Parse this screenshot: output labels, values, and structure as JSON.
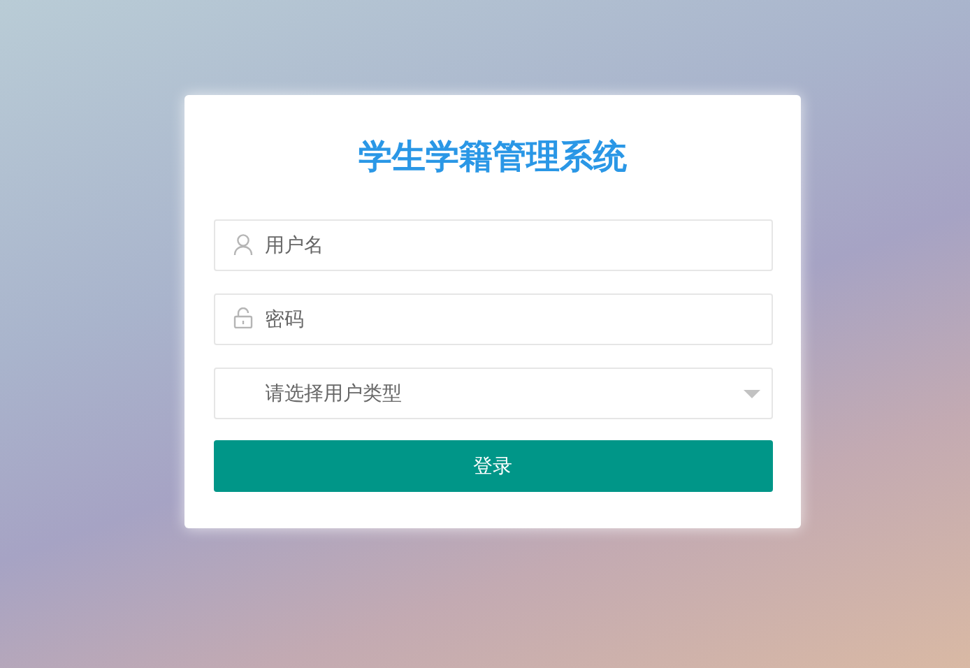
{
  "title": "学生学籍管理系统",
  "fields": [
    {
      "kind": "text",
      "placeholder": "用户名"
    },
    {
      "kind": "password",
      "placeholder": "密码"
    },
    {
      "kind": "select",
      "placeholder": "请选择用户类型"
    }
  ],
  "button": "登录"
}
